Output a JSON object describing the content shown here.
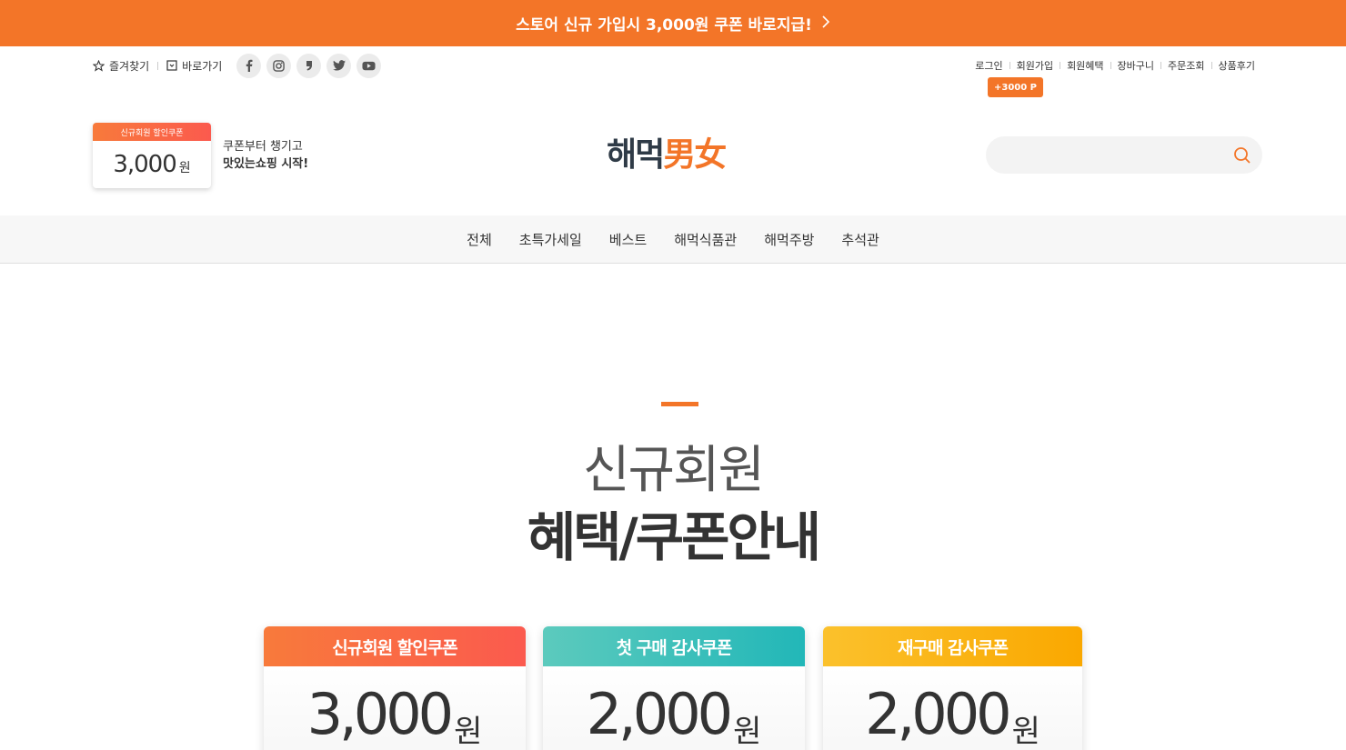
{
  "colors": {
    "accent": "#f37528",
    "nav_bg": "#f7f7f7",
    "coupon_orange": "#fb5a4e",
    "coupon_teal": "#22b7b8",
    "coupon_yellow": "#faa800"
  },
  "top_banner": {
    "text": "스토어 신규 가입시 3,000원 쿠폰 바로지급!",
    "icon": "chevron-right-icon"
  },
  "util_left": {
    "bookmark": "즐겨찾기",
    "shortcut": "바로가기"
  },
  "social": [
    {
      "name": "facebook-icon"
    },
    {
      "name": "instagram-icon"
    },
    {
      "name": "blog-icon"
    },
    {
      "name": "twitter-icon"
    },
    {
      "name": "youtube-icon"
    }
  ],
  "util_right": [
    "로그인",
    "회원가입",
    "회원혜택",
    "장바구니",
    "주문조회",
    "상품후기"
  ],
  "point_badge": "+3000 P",
  "mini_coupon": {
    "header": "신규회원 할인쿠폰",
    "amount": "3,000",
    "unit": "원"
  },
  "mini_copy": {
    "line1": "쿠폰부터 챙기고",
    "line2": "맛있는쇼핑 시작!"
  },
  "logo": {
    "part1": "해먹",
    "part2": "男女"
  },
  "search": {
    "placeholder": "",
    "icon": "search-icon"
  },
  "nav": [
    "전체",
    "초특가세일",
    "베스트",
    "해먹식품관",
    "해먹주방",
    "추석관"
  ],
  "hero": {
    "line1": "신규회원",
    "line2": "혜택/쿠폰안내"
  },
  "coupons": [
    {
      "title": "신규회원 할인쿠폰",
      "amount": "3,000",
      "unit": "원"
    },
    {
      "title": "첫 구매 감사쿠폰",
      "amount": "2,000",
      "unit": "원"
    },
    {
      "title": "재구매 감사쿠폰",
      "amount": "2,000",
      "unit": "원"
    }
  ]
}
